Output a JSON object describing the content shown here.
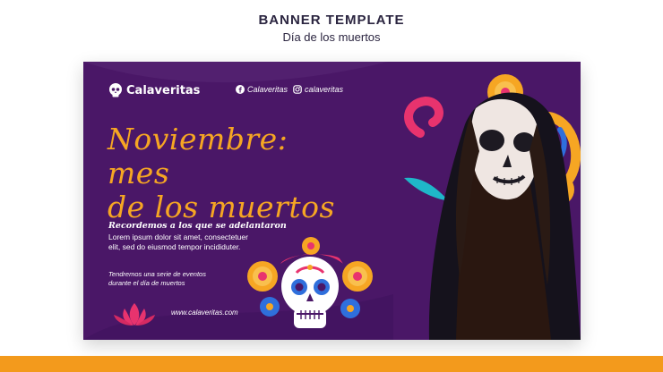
{
  "page": {
    "title": "BANNER TEMPLATE",
    "subtitle": "Día de los muertos"
  },
  "banner": {
    "brand": "Calaveritas",
    "social": [
      {
        "icon": "facebook-icon",
        "label": "Calaveritas"
      },
      {
        "icon": "instagram-icon",
        "label": "calaveritas"
      }
    ],
    "headline_line1": "Noviembre: mes",
    "headline_line2": "de los muertos",
    "subhead": "Recordemos a los que se adelantaron",
    "body_line1": "Lorem ipsum dolor sit amet, consectetuer",
    "body_line2": "elit, sed do eiusmod tempor incididuter.",
    "events_line1": "Tendremos una serie de eventos",
    "events_line2": "durante el día de muertos",
    "url": "www.calaveritas.com"
  },
  "colors": {
    "background": "#4a1767",
    "accent_orange": "#f6a623",
    "accent_pink": "#e8336e",
    "accent_blue": "#2f6fdc",
    "accent_teal": "#1fb7c9",
    "bottom_bar": "#f39a1c"
  }
}
